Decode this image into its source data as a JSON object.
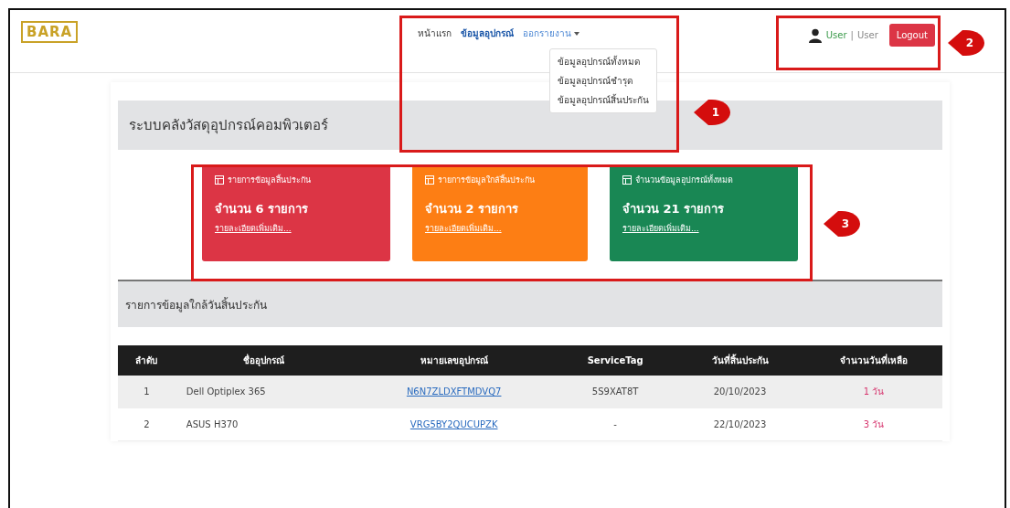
{
  "logo": {
    "text": "BARA"
  },
  "nav": {
    "items": [
      {
        "label": "หน้าแรก",
        "selected": false
      },
      {
        "label": "ข้อมูลอุปกรณ์",
        "selected": true
      },
      {
        "label": "ออกรายงาน",
        "selected": false,
        "dropdown": true
      }
    ],
    "dropdown_items": [
      "ข้อมูลอุปกรณ์ทั้งหมด",
      "ข้อมูลอุปกรณ์ชำรุด",
      "ข้อมูลอุปกรณ์สิ้นประกัน"
    ]
  },
  "user": {
    "name": "User",
    "separator": "|",
    "role": "User",
    "logout": "Logout"
  },
  "page_title": "ระบบคลังวัสดุอุปกรณ์คอมพิวเตอร์",
  "cards": [
    {
      "title": "รายการข้อมูลสิ้นประกัน",
      "count": "จำนวน 6 รายการ",
      "link": "รายละเอียดเพิ่มเติม...",
      "color": "#dc3545"
    },
    {
      "title": "รายการข้อมูลใกล้สิ้นประกัน",
      "count": "จำนวน 2 รายการ",
      "link": "รายละเอียดเพิ่มเติม...",
      "color": "#fd7e14"
    },
    {
      "title": "จำนวนข้อมูลอุปกรณ์ทั้งหมด",
      "count": "จำนวน 21 รายการ",
      "link": "รายละเอียดเพิ่มเติม...",
      "color": "#198754"
    }
  ],
  "section_title": "รายการข้อมูลใกล้วันสิ้นประกัน",
  "table": {
    "columns": [
      "ลำดับ",
      "ชื่ออุปกรณ์",
      "หมายเลขอุปกรณ์",
      "ServiceTag",
      "วันที่สิ้นประกัน",
      "จำนวนวันที่เหลือ"
    ],
    "rows": [
      {
        "no": "1",
        "name": "Dell Optiplex 365",
        "serial": "N6N7ZLDXFTMDVQ7",
        "service_tag": "5S9XAT8T",
        "expiry": "20/10/2023",
        "days_left": "1 วัน"
      },
      {
        "no": "2",
        "name": "ASUS H370",
        "serial": "VRG5BY2QUCUPZK",
        "service_tag": "-",
        "expiry": "22/10/2023",
        "days_left": "3 วัน"
      }
    ]
  },
  "annotations": [
    {
      "label": "1"
    },
    {
      "label": "2"
    },
    {
      "label": "3"
    }
  ]
}
